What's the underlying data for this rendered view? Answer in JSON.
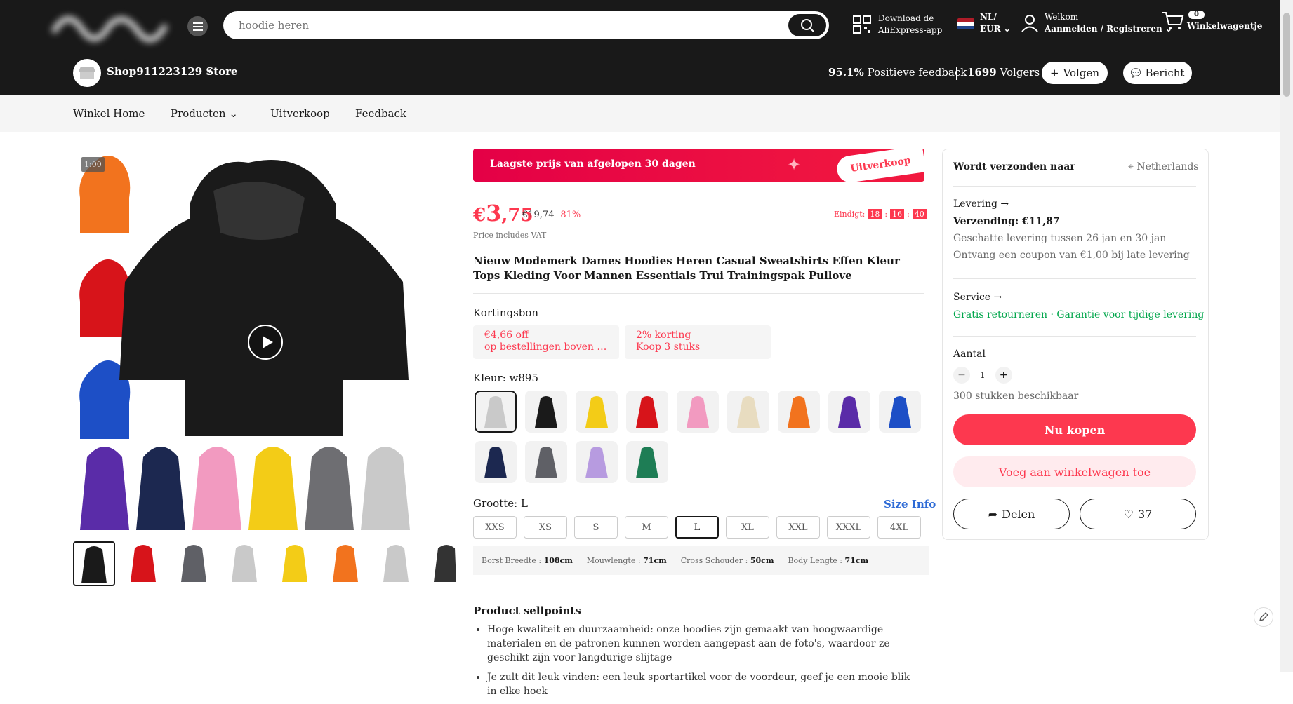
{
  "header": {
    "search_placeholder": "hoodie heren",
    "download_line1": "Download de",
    "download_line2": "AliExpress-app",
    "lang_line1": "NL/",
    "lang_line2": "EUR",
    "welcome_line1": "Welkom",
    "welcome_line2": "Aanmelden / Registreren",
    "cart_count": "0",
    "cart_label": "Winkelwagentje"
  },
  "store": {
    "name": "Shop911223129 Store",
    "feedback_value": "95.1%",
    "feedback_label": "Positieve feedback",
    "followers_value": "1699",
    "followers_label": "Volgers",
    "follow_label": "Volgen",
    "message_label": "Bericht"
  },
  "subnav": [
    "Winkel Home",
    "Producten",
    "Uitverkoop",
    "Feedback"
  ],
  "gallery": {
    "video_time": "1:00"
  },
  "product": {
    "banner_text": "Laagste prijs van afgelopen 30 dagen",
    "banner_tag": "Uitverkoop",
    "price_symbol": "€",
    "price_main": "3",
    "price_decimal": ",75",
    "old_price": "€19,74",
    "discount": "-81%",
    "ends_label": "Eindigt:",
    "ends_h": "18",
    "ends_m": "16",
    "ends_s": "40",
    "vat_text": "Price includes VAT",
    "title": "Nieuw Modemerk Dames Hoodies Heren Casual Sweatshirts Effen Kleur Tops Kleding Voor Mannen Essentials Trui Trainingspak Pullove",
    "coupon_label": "Kortingsbon",
    "coupons": [
      {
        "line1": "€4,66 off",
        "line2": "op bestellingen boven d..."
      },
      {
        "line1": "2% korting",
        "line2": "Koop 3 stuks"
      }
    ],
    "color_label": "Kleur: w895",
    "size_label": "Grootte: L",
    "size_info": "Size Info",
    "sizes": [
      "XXS",
      "XS",
      "S",
      "M",
      "L",
      "XL",
      "XXL",
      "XXXL",
      "4XL"
    ],
    "selected_size": "L",
    "measurements": [
      {
        "label": "Borst Breedte :",
        "value": "108cm"
      },
      {
        "label": "Mouwlengte :",
        "value": "71cm"
      },
      {
        "label": "Cross Schouder :",
        "value": "50cm"
      },
      {
        "label": "Body Lengte :",
        "value": "71cm"
      }
    ],
    "sellpoints_title": "Product sellpoints",
    "sellpoints": [
      "Hoge kwaliteit en duurzaamheid: onze hoodies zijn gemaakt van hoogwaardige materialen en de patronen kunnen worden aangepast aan de foto's, waardoor ze geschikt zijn voor langdurige slijtage",
      "Je zult dit leuk vinden: een leuk sportartikel voor de voordeur, geef je een mooie blik in elke hoek"
    ]
  },
  "side": {
    "ship_to_label": "Wordt verzonden naar",
    "ship_to_country": "Netherlands",
    "delivery_label": "Levering",
    "shipping": "Verzending: €11,87",
    "estimate": "Geschatte levering tussen 26 jan en 30 jan",
    "coupon_late": "Ontvang een coupon van €1,00 bij late levering",
    "service_label": "Service",
    "service_free_returns": "Gratis retourneren",
    "service_dot": "·",
    "service_guarantee": "Garantie voor tijdige levering",
    "quantity_label": "Aantal",
    "quantity_value": "1",
    "available": "300 stukken beschikbaar",
    "buy_now": "Nu kopen",
    "add_to_cart": "Voeg aan winkelwagen toe",
    "share": "Delen",
    "wishlist_count": "37"
  },
  "colors": {
    "main_hoodie": "#1a1a1a",
    "accent_red": "#fd384f",
    "header_bg": "#191919",
    "thumb_colors": [
      "#f2731e",
      "#d7141a",
      "#1d4fc6"
    ],
    "bottom_strip": [
      "#5a2ca8",
      "#1c2850",
      "#f29ac0",
      "#f3cc17",
      "#6e6e72",
      "#c9c9c9"
    ],
    "thumb_row": [
      "#1a1a1a",
      "#d7141a",
      "#5f6066",
      "#c9c9c9",
      "#f3cc17",
      "#f2731e",
      "#c9c9c9",
      "#333"
    ],
    "swatches": [
      "#c9c9c9",
      "#1a1a1a",
      "#f3cc17",
      "#d7141a",
      "#f29ac0",
      "#e8dcc0",
      "#f2731e",
      "#5a2ca8",
      "#1d4fc6",
      "#1c2850",
      "#5f6066",
      "#b79be0",
      "#1e7d55"
    ]
  }
}
